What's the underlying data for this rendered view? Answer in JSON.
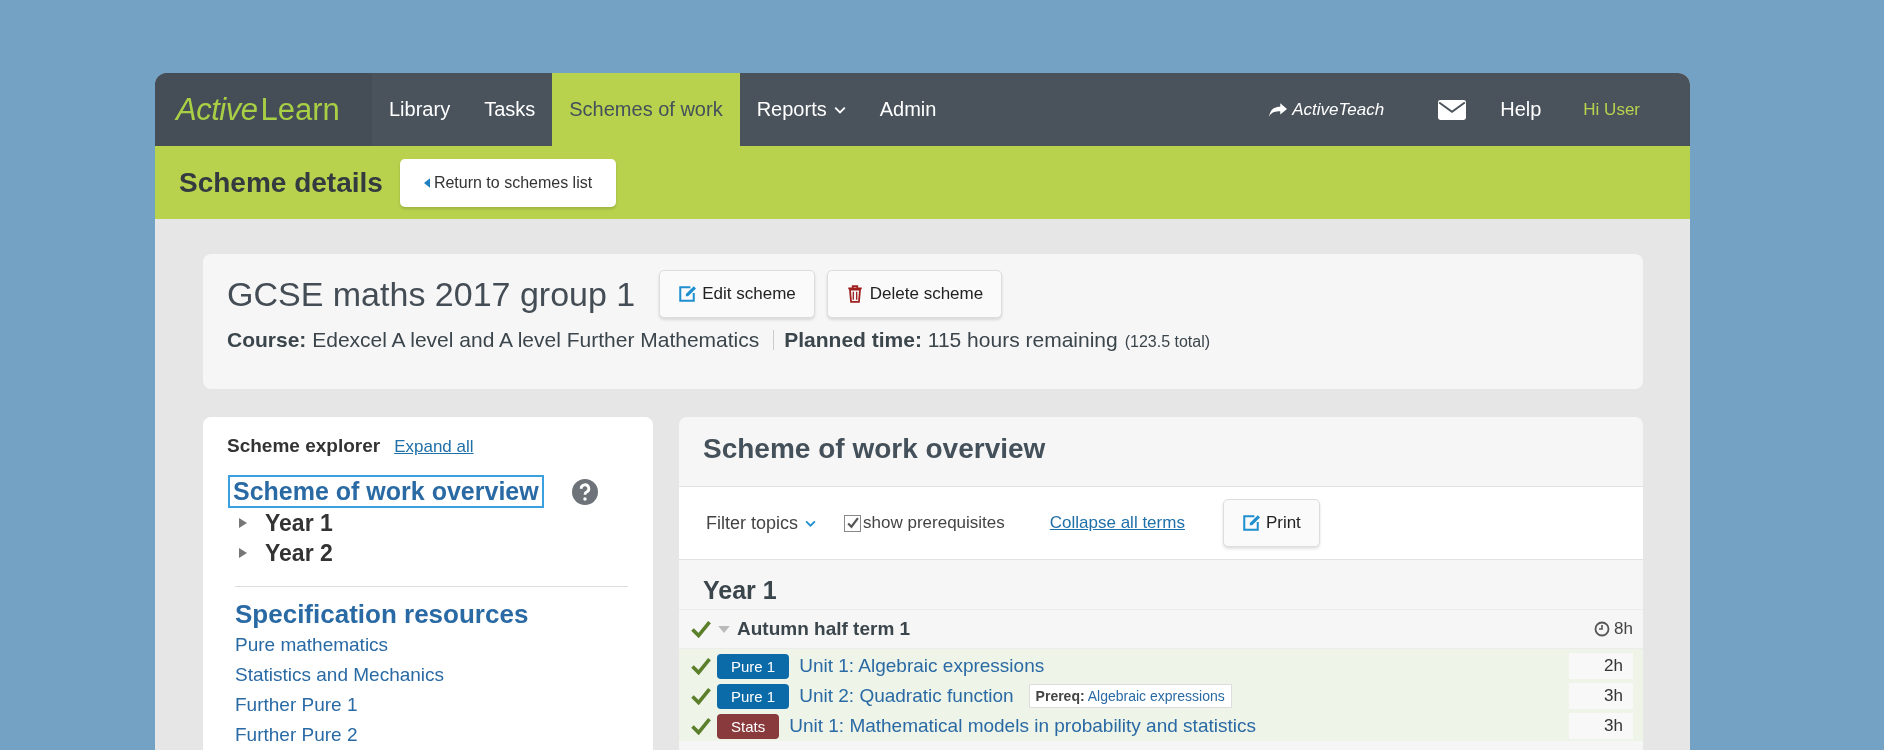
{
  "logo": {
    "part1": "Active",
    "part2": "Learn"
  },
  "nav": [
    {
      "label": "Library",
      "selected": false,
      "dropdown": false
    },
    {
      "label": "Tasks",
      "selected": false,
      "dropdown": false
    },
    {
      "label": "Schemes of work",
      "selected": true,
      "dropdown": false
    },
    {
      "label": "Reports",
      "selected": false,
      "dropdown": true
    },
    {
      "label": "Admin",
      "selected": false,
      "dropdown": false
    }
  ],
  "nav_right": {
    "activeteach": "ActiveTeach",
    "help": "Help",
    "user": "Hi User"
  },
  "subheader": {
    "title": "Scheme details",
    "back_button": "Return to schemes list"
  },
  "scheme": {
    "title": "GCSE maths 2017 group 1",
    "edit_button": "Edit scheme",
    "delete_button": "Delete scheme",
    "course_label": "Course:",
    "course": "Edexcel A level and A level Further Mathematics",
    "planned_label": "Planned time:",
    "planned": "115 hours remaining",
    "total": "(123.5 total)"
  },
  "explorer": {
    "title": "Scheme explorer",
    "expand_all": "Expand all",
    "overview_link": "Scheme of work overview",
    "years": [
      {
        "label": "Year 1",
        "expanded": false
      },
      {
        "label": "Year 2",
        "expanded": false
      }
    ],
    "resources_title": "Specification resources",
    "resources": [
      "Pure mathematics",
      "Statistics and Mechanics",
      "Further Pure 1",
      "Further Pure 2"
    ]
  },
  "overview": {
    "title": "Scheme of work overview",
    "filter": "Filter topics",
    "show_prerequisites": {
      "label": "show prerequisites",
      "checked": true
    },
    "collapse": "Collapse all terms",
    "print": "Print",
    "year": "Year 1",
    "term": {
      "title": "Autumn half term 1",
      "done": true,
      "expanded": true,
      "hours": "8h"
    },
    "units": [
      {
        "done": true,
        "tag": "Pure 1",
        "color": "#0b6aa8",
        "title": "Unit 1: Algebraic expressions",
        "hours": "2h"
      },
      {
        "done": true,
        "tag": "Pure 1",
        "color": "#0b6aa8",
        "title": "Unit 2: Quadratic function",
        "prereq_label": "Prereq:",
        "prereq": "Algebraic expressions",
        "hours": "3h"
      },
      {
        "done": true,
        "tag": "Stats",
        "color": "#883a3c",
        "title": "Unit 1: Mathematical models in probability and statistics",
        "hours": "3h"
      }
    ]
  }
}
